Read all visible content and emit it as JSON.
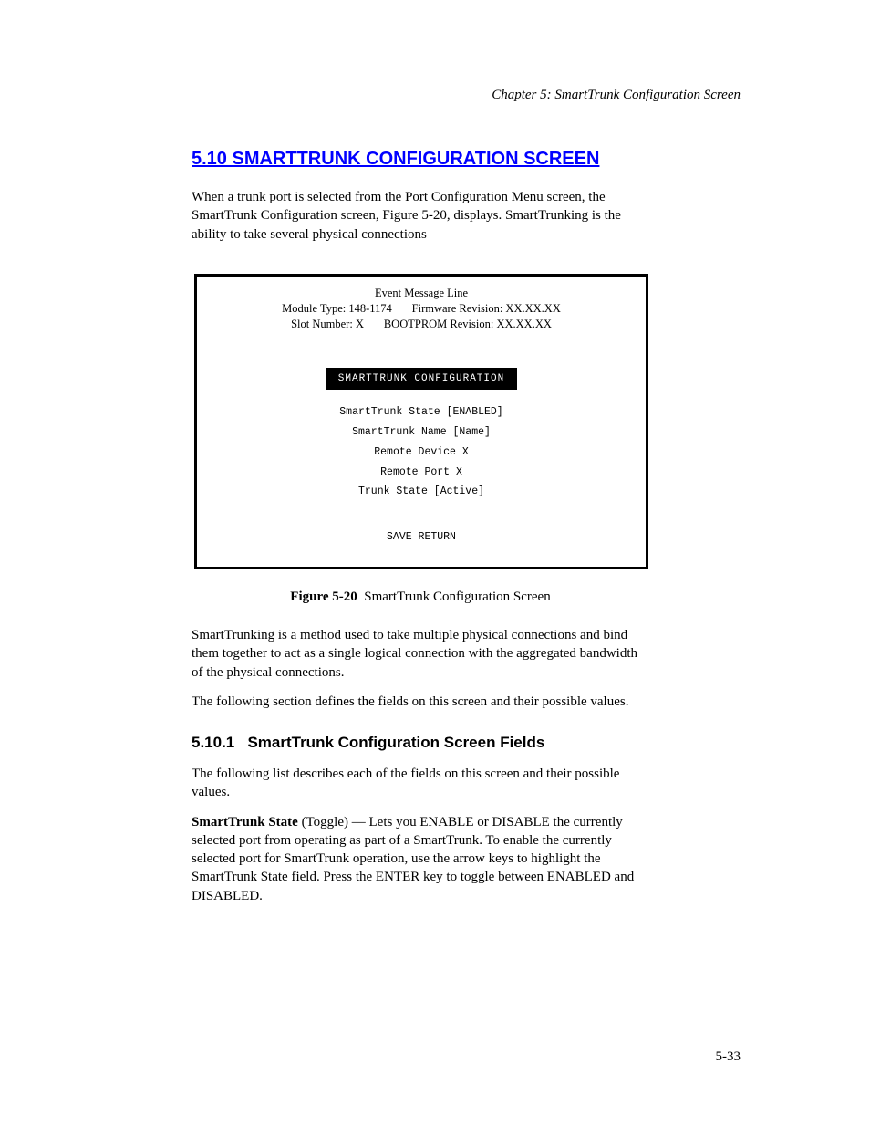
{
  "header": {
    "right": "Chapter 5:  SmartTrunk Configuration Screen"
  },
  "section": {
    "title": "5.10  SMARTTRUNK CONFIGURATION SCREEN"
  },
  "intro": {
    "p1": "When a trunk port is selected from the Port Configuration Menu screen, the SmartTrunk Configuration screen, Figure 5-20, displays. SmartTrunking is the ability to take several physical connections"
  },
  "figure": {
    "event": "Event Message Line",
    "module": "Module Type:  148-1174",
    "slot": "Slot Number:  X",
    "fw": "Firmware Revision:  XX.XX.XX",
    "boot": "BOOTPROM Revision:  XX.XX.XX",
    "panel_title": "SMARTTRUNK CONFIGURATION",
    "rows": [
      "SmartTrunk State   [ENABLED]",
      "SmartTrunk Name   [Name]",
      "Remote Device   X",
      "Remote Port   X",
      "Trunk State   [Active]"
    ],
    "caption_label": "Figure 5-20",
    "caption_text": "SmartTrunk Configuration Screen",
    "actions": "SAVE         RETURN"
  },
  "body2": {
    "p1": "SmartTrunking is a method used to take multiple physical connections and bind them together to act as a single logical connection with the aggregated bandwidth of the physical connections.",
    "p2": "The following section defines the fields on this screen and their possible values."
  },
  "subsection": {
    "number": "5.10.1",
    "title": "SmartTrunk Configuration Screen Fields"
  },
  "body3": {
    "p1": "The following list describes each of the fields on this screen and their possible values.",
    "st_state_label": "SmartTrunk State",
    "st_state_meta": "(Toggle)",
    "st_state_p": "Lets you ENABLE or DISABLE the currently selected port from operating as part of a SmartTrunk. To enable the currently selected port for SmartTrunk operation, use the arrow keys to highlight the SmartTrunk State field. Press the ENTER key to toggle between ENABLED and DISABLED."
  },
  "footer": {
    "page": "5-33"
  }
}
